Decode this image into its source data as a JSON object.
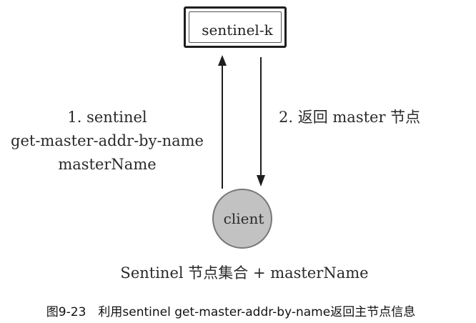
{
  "nodes": {
    "sentinel": "sentinel-k",
    "client": "client"
  },
  "edges": {
    "request": {
      "line1": "1. sentinel",
      "line2": "get-master-addr-by-name",
      "line3": "masterName"
    },
    "response": "2. 返回 master 节点"
  },
  "note": "Sentinel 节点集合 + masterName",
  "caption": "图9-23　利用sentinel get-master-addr-by-name返回主节点信息"
}
